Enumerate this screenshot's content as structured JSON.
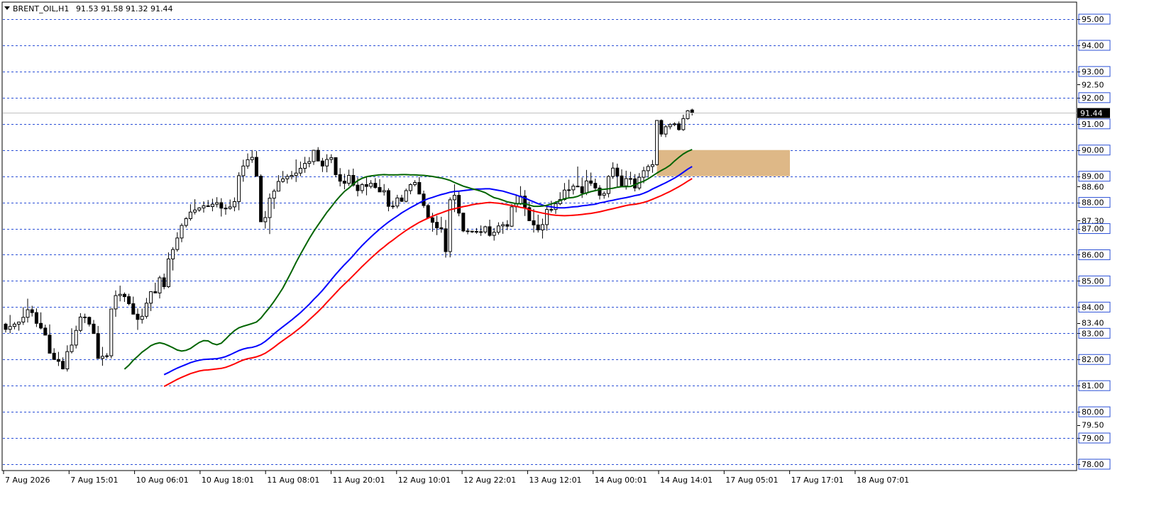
{
  "header": {
    "symbol": "BRENT_OIL,H1",
    "ohlc": "91.53 91.58 91.32 91.44"
  },
  "current_price_label": "91.44",
  "colors": {
    "bull_body": "#ffffff",
    "bear_body": "#000000",
    "ema_fast": "#006400",
    "ema_mid": "#0000ff",
    "ema_slow": "#ff0000",
    "zone": "#deb887",
    "grid": "#2a4fd6",
    "price_tag_bg": "#000000"
  },
  "chart_data": {
    "type": "candlestick",
    "title": "BRENT_OIL,H1",
    "ylim": [
      77.8,
      95.6
    ],
    "y_grid_levels": [
      "95.00",
      "94.00",
      "93.00",
      "92.00",
      "91.00",
      "90.00",
      "89.00",
      "88.00",
      "87.00",
      "86.00",
      "85.00",
      "84.00",
      "83.00",
      "82.00",
      "81.00",
      "80.00",
      "79.00",
      "78.00"
    ],
    "y_tick_labels": [
      "95.00",
      "94.00",
      "93.00",
      "92.50",
      "92.00",
      "91.00",
      "90.00",
      "89.00",
      "88.60",
      "88.00",
      "87.30",
      "87.00",
      "86.00",
      "85.00",
      "84.00",
      "83.40",
      "83.00",
      "82.00",
      "81.00",
      "80.00",
      "79.50",
      "79.00",
      "78.00"
    ],
    "x_tick_labels": [
      "7 Aug 2026",
      "7 Aug 15:01",
      "10 Aug 06:01",
      "10 Aug 18:01",
      "11 Aug 08:01",
      "11 Aug 20:01",
      "12 Aug 10:01",
      "12 Aug 22:01",
      "13 Aug 12:01",
      "14 Aug 00:01",
      "14 Aug 14:01",
      "17 Aug 05:01",
      "17 Aug 17:01",
      "18 Aug 07:01"
    ],
    "zone": {
      "from_price": 89.0,
      "to_price": 90.0,
      "start_bar": 148,
      "end_bar": 175
    },
    "ohlc": [
      [
        83.35,
        83.4,
        83.03,
        83.15
      ],
      [
        83.15,
        83.7,
        83.0,
        83.26
      ],
      [
        83.26,
        83.43,
        83.15,
        83.35
      ],
      [
        83.35,
        83.42,
        83.1,
        83.43
      ],
      [
        83.43,
        84.0,
        83.32,
        83.61
      ],
      [
        83.61,
        84.32,
        83.41,
        83.9
      ],
      [
        83.9,
        84.05,
        83.64,
        83.79
      ],
      [
        83.79,
        83.95,
        83.24,
        83.38
      ],
      [
        83.38,
        83.8,
        83.15,
        83.2
      ],
      [
        83.2,
        83.33,
        82.97,
        82.93
      ],
      [
        82.93,
        83.34,
        82.7,
        82.24
      ],
      [
        82.24,
        82.43,
        82.0,
        82.0
      ],
      [
        82.0,
        82.29,
        81.75,
        81.93
      ],
      [
        81.93,
        82.08,
        81.62,
        81.64
      ],
      [
        81.64,
        82.54,
        81.54,
        82.3
      ],
      [
        82.3,
        83.19,
        82.23,
        82.55
      ],
      [
        82.55,
        83.29,
        82.42,
        83.11
      ],
      [
        83.11,
        83.77,
        83.04,
        83.62
      ],
      [
        83.62,
        83.75,
        83.39,
        83.61
      ],
      [
        83.61,
        83.64,
        83.26,
        83.35
      ],
      [
        83.35,
        83.51,
        83.26,
        82.99
      ],
      [
        82.99,
        83.28,
        82.05,
        82.04
      ],
      [
        82.04,
        82.48,
        81.76,
        82.12
      ],
      [
        82.12,
        82.24,
        82.04,
        82.14
      ],
      [
        82.14,
        83.65,
        82.04,
        83.93
      ],
      [
        83.93,
        84.64,
        83.63,
        84.44
      ],
      [
        84.44,
        84.82,
        84.22,
        84.49
      ],
      [
        84.49,
        84.56,
        84.2,
        84.4
      ],
      [
        84.4,
        84.51,
        84.07,
        84.13
      ],
      [
        84.13,
        84.4,
        83.85,
        83.73
      ],
      [
        83.73,
        83.95,
        83.13,
        83.53
      ],
      [
        83.53,
        83.94,
        83.37,
        83.65
      ],
      [
        83.65,
        84.35,
        83.56,
        84.15
      ],
      [
        84.15,
        84.58,
        83.85,
        84.59
      ],
      [
        84.59,
        84.93,
        84.57,
        84.54
      ],
      [
        84.54,
        85.2,
        84.33,
        85.12
      ],
      [
        85.12,
        85.28,
        84.68,
        84.78
      ],
      [
        84.78,
        86.09,
        84.73,
        85.84
      ],
      [
        85.84,
        86.29,
        85.4,
        86.2
      ],
      [
        86.2,
        86.86,
        86.12,
        86.64
      ],
      [
        86.64,
        87.2,
        86.48,
        87.12
      ],
      [
        87.12,
        87.44,
        87.04,
        87.38
      ],
      [
        87.38,
        87.93,
        87.3,
        87.63
      ],
      [
        87.63,
        88.12,
        87.54,
        87.71
      ],
      [
        87.71,
        87.82,
        87.64,
        87.79
      ],
      [
        87.79,
        88.04,
        87.61,
        87.87
      ],
      [
        87.87,
        88.09,
        87.86,
        87.84
      ],
      [
        87.84,
        88.14,
        87.66,
        87.93
      ],
      [
        87.93,
        88.2,
        87.81,
        87.99
      ],
      [
        87.99,
        88.16,
        87.46,
        87.78
      ],
      [
        87.78,
        87.93,
        87.53,
        87.77
      ],
      [
        87.77,
        88.11,
        87.72,
        87.83
      ],
      [
        87.83,
        88.19,
        87.66,
        88.03
      ],
      [
        88.03,
        89.15,
        87.7,
        89.02
      ],
      [
        89.02,
        89.63,
        88.79,
        89.39
      ],
      [
        89.39,
        89.87,
        89.28,
        89.63
      ],
      [
        89.63,
        90.0,
        89.51,
        89.72
      ],
      [
        89.72,
        89.96,
        89.14,
        89.0
      ],
      [
        89.0,
        89.07,
        87.91,
        87.26
      ],
      [
        87.26,
        87.67,
        87.0,
        87.42
      ],
      [
        87.42,
        88.34,
        86.79,
        88.16
      ],
      [
        88.16,
        88.51,
        87.75,
        88.43
      ],
      [
        88.43,
        89.04,
        88.42,
        88.8
      ],
      [
        88.8,
        89.2,
        88.75,
        88.9
      ],
      [
        88.9,
        89.08,
        88.72,
        88.99
      ],
      [
        88.99,
        89.2,
        88.88,
        89.03
      ],
      [
        89.03,
        89.64,
        88.78,
        89.12
      ],
      [
        89.12,
        89.56,
        89.0,
        89.3
      ],
      [
        89.3,
        89.74,
        89.13,
        89.49
      ],
      [
        89.49,
        89.73,
        89.34,
        89.56
      ],
      [
        89.56,
        90.01,
        89.43,
        89.99
      ],
      [
        89.99,
        90.11,
        89.7,
        89.58
      ],
      [
        89.58,
        89.7,
        89.16,
        89.39
      ],
      [
        89.39,
        89.84,
        89.15,
        89.64
      ],
      [
        89.64,
        89.84,
        89.5,
        89.71
      ],
      [
        89.71,
        89.69,
        88.96,
        89.06
      ],
      [
        89.06,
        89.31,
        88.61,
        88.81
      ],
      [
        88.81,
        89.09,
        88.5,
        88.73
      ],
      [
        88.73,
        89.25,
        88.63,
        89.03
      ],
      [
        89.03,
        89.29,
        88.6,
        88.66
      ],
      [
        88.66,
        88.95,
        88.23,
        88.45
      ],
      [
        88.45,
        88.74,
        88.34,
        88.68
      ],
      [
        88.68,
        88.97,
        88.27,
        88.61
      ],
      [
        88.61,
        88.85,
        88.53,
        88.73
      ],
      [
        88.73,
        88.93,
        88.52,
        88.57
      ],
      [
        88.57,
        88.89,
        88.51,
        88.4
      ],
      [
        88.4,
        88.7,
        88.26,
        88.45
      ],
      [
        88.45,
        88.54,
        87.66,
        87.85
      ],
      [
        87.85,
        88.06,
        87.75,
        87.86
      ],
      [
        87.86,
        88.29,
        87.77,
        88.17
      ],
      [
        88.17,
        88.29,
        88.02,
        88.04
      ],
      [
        88.04,
        88.53,
        88.0,
        88.45
      ],
      [
        88.45,
        88.73,
        88.31,
        88.68
      ],
      [
        88.68,
        88.85,
        88.61,
        88.76
      ],
      [
        88.76,
        88.97,
        88.31,
        88.32
      ],
      [
        88.32,
        88.45,
        87.79,
        87.88
      ],
      [
        87.88,
        87.95,
        87.48,
        87.41
      ],
      [
        87.41,
        87.6,
        86.88,
        87.24
      ],
      [
        87.24,
        87.49,
        86.75,
        87.03
      ],
      [
        87.03,
        87.45,
        86.84,
        86.99
      ],
      [
        86.99,
        87.33,
        85.89,
        86.12
      ],
      [
        86.12,
        88.19,
        85.9,
        88.1
      ],
      [
        88.1,
        88.69,
        87.63,
        88.27
      ],
      [
        88.27,
        88.41,
        87.47,
        87.59
      ],
      [
        87.59,
        87.61,
        86.86,
        86.91
      ],
      [
        86.91,
        87.01,
        86.78,
        86.9
      ],
      [
        86.9,
        86.92,
        86.83,
        86.89
      ],
      [
        86.89,
        87.02,
        86.8,
        86.88
      ],
      [
        86.88,
        87.12,
        86.72,
        86.87
      ],
      [
        86.87,
        87.11,
        86.8,
        87.07
      ],
      [
        87.07,
        87.34,
        86.69,
        86.74
      ],
      [
        86.74,
        87.02,
        86.54,
        86.86
      ],
      [
        86.86,
        87.24,
        86.77,
        87.1
      ],
      [
        87.1,
        87.26,
        86.8,
        87.15
      ],
      [
        87.15,
        87.32,
        86.94,
        87.09
      ],
      [
        87.09,
        87.94,
        87.06,
        87.83
      ],
      [
        87.83,
        88.29,
        87.62,
        87.94
      ],
      [
        87.94,
        88.62,
        87.9,
        88.24
      ],
      [
        88.24,
        88.47,
        87.48,
        87.8
      ],
      [
        87.8,
        88.03,
        87.3,
        87.3
      ],
      [
        87.3,
        87.75,
        86.85,
        87.14
      ],
      [
        87.14,
        87.53,
        86.85,
        86.95
      ],
      [
        86.95,
        87.38,
        86.62,
        87.15
      ],
      [
        87.15,
        87.84,
        86.92,
        87.73
      ],
      [
        87.73,
        88.06,
        87.62,
        87.73
      ],
      [
        87.73,
        88.05,
        87.56,
        87.95
      ],
      [
        87.95,
        88.39,
        87.89,
        88.11
      ],
      [
        88.11,
        88.74,
        88.06,
        88.47
      ],
      [
        88.47,
        88.87,
        88.19,
        88.48
      ],
      [
        88.48,
        88.71,
        88.3,
        88.62
      ],
      [
        88.62,
        89.37,
        88.6,
        88.6
      ],
      [
        88.6,
        88.95,
        88.17,
        88.36
      ],
      [
        88.36,
        89.24,
        88.28,
        88.82
      ],
      [
        88.82,
        89.14,
        88.63,
        88.73
      ],
      [
        88.73,
        88.91,
        88.45,
        88.55
      ],
      [
        88.55,
        88.66,
        88.11,
        88.27
      ],
      [
        88.27,
        88.42,
        88.14,
        88.34
      ],
      [
        88.34,
        89.04,
        88.19,
        88.99
      ],
      [
        88.99,
        89.53,
        88.9,
        89.31
      ],
      [
        89.31,
        89.48,
        88.57,
        89.01
      ],
      [
        89.01,
        89.26,
        88.64,
        88.63
      ],
      [
        88.63,
        89.21,
        88.49,
        88.91
      ],
      [
        88.91,
        89.17,
        88.68,
        88.9
      ],
      [
        88.9,
        89.08,
        88.42,
        88.55
      ],
      [
        88.55,
        89.12,
        88.47,
        88.96
      ],
      [
        88.96,
        89.36,
        88.73,
        89.21
      ],
      [
        89.21,
        89.45,
        88.95,
        89.37
      ],
      [
        89.37,
        89.62,
        89.13,
        89.44
      ],
      [
        89.44,
        90.12,
        89.41,
        91.13
      ],
      [
        91.13,
        91.17,
        90.51,
        90.61
      ],
      [
        90.61,
        90.96,
        90.49,
        90.89
      ],
      [
        90.89,
        91.03,
        90.79,
        90.97
      ],
      [
        90.97,
        91.06,
        90.91,
        91.0
      ],
      [
        91.0,
        91.09,
        90.74,
        90.78
      ],
      [
        90.78,
        91.35,
        90.73,
        91.2
      ],
      [
        91.2,
        91.53,
        91.16,
        91.5
      ],
      [
        91.53,
        91.58,
        91.32,
        91.44
      ]
    ],
    "ema_fast": [
      81.63,
      81.78,
      81.97,
      82.12,
      82.28,
      82.4,
      82.53,
      82.6,
      82.64,
      82.6,
      82.53,
      82.45,
      82.36,
      82.32,
      82.35,
      82.42,
      82.54,
      82.65,
      82.72,
      82.71,
      82.61,
      82.56,
      82.62,
      82.78,
      82.95,
      83.1,
      83.21,
      83.27,
      83.32,
      83.37,
      83.43,
      83.58,
      83.79,
      83.99,
      84.22,
      84.47,
      84.73,
      85.05,
      85.37,
      85.71,
      86.02,
      86.32,
      86.62,
      86.89,
      87.14,
      87.38,
      87.62,
      87.83,
      88.05,
      88.24,
      88.42,
      88.55,
      88.7,
      88.83,
      88.92,
      88.98,
      89.01,
      89.03,
      89.05,
      89.06,
      89.05,
      89.05,
      89.05,
      89.06,
      89.06,
      89.05,
      89.05,
      89.04,
      89.03,
      89.01,
      88.99,
      88.96,
      88.93,
      88.89,
      88.84,
      88.76,
      88.69,
      88.62,
      88.57,
      88.52,
      88.48,
      88.43,
      88.37,
      88.27,
      88.18,
      88.14,
      88.08,
      88.02,
      87.99,
      87.95,
      87.95,
      87.94,
      87.9,
      87.85,
      87.85,
      87.86,
      87.89,
      87.94,
      88.0,
      88.07,
      88.14,
      88.17,
      88.19,
      88.23,
      88.31,
      88.36,
      88.41,
      88.45,
      88.49,
      88.5,
      88.52,
      88.54,
      88.58,
      88.6,
      88.6,
      88.61,
      88.67,
      88.75,
      88.81,
      88.9,
      89.01,
      89.12,
      89.22,
      89.31,
      89.42,
      89.58,
      89.72,
      89.85,
      89.95,
      90.02
    ],
    "ema_mid": [
      81.42,
      81.5,
      81.59,
      81.67,
      81.74,
      81.81,
      81.88,
      81.93,
      81.97,
      82.0,
      82.01,
      82.02,
      82.03,
      82.06,
      82.11,
      82.18,
      82.26,
      82.34,
      82.4,
      82.44,
      82.46,
      82.51,
      82.58,
      82.69,
      82.83,
      82.98,
      83.12,
      83.25,
      83.38,
      83.51,
      83.65,
      83.79,
      83.95,
      84.11,
      84.29,
      84.46,
      84.64,
      84.84,
      85.05,
      85.25,
      85.44,
      85.62,
      85.79,
      85.97,
      86.17,
      86.35,
      86.52,
      86.68,
      86.83,
      86.98,
      87.12,
      87.25,
      87.37,
      87.48,
      87.6,
      87.7,
      87.8,
      87.89,
      87.98,
      88.07,
      88.14,
      88.19,
      88.25,
      88.3,
      88.34,
      88.39,
      88.42,
      88.43,
      88.45,
      88.47,
      88.49,
      88.51,
      88.51,
      88.52,
      88.52,
      88.49,
      88.46,
      88.43,
      88.38,
      88.33,
      88.28,
      88.22,
      88.17,
      88.09,
      88.02,
      87.95,
      87.9,
      87.85,
      87.83,
      87.8,
      87.79,
      87.79,
      87.81,
      87.83,
      87.84,
      87.87,
      87.89,
      87.91,
      87.93,
      87.98,
      88.01,
      88.05,
      88.08,
      88.12,
      88.15,
      88.18,
      88.22,
      88.26,
      88.29,
      88.35,
      88.42,
      88.51,
      88.59,
      88.67,
      88.75,
      88.84,
      88.93,
      89.03,
      89.15,
      89.27,
      89.37
    ],
    "ema_slow": [
      80.97,
      81.06,
      81.15,
      81.24,
      81.32,
      81.39,
      81.46,
      81.51,
      81.56,
      81.59,
      81.6,
      81.62,
      81.64,
      81.66,
      81.7,
      81.76,
      81.83,
      81.91,
      81.98,
      82.03,
      82.06,
      82.1,
      82.16,
      82.24,
      82.35,
      82.47,
      82.6,
      82.72,
      82.84,
      82.96,
      83.09,
      83.22,
      83.36,
      83.52,
      83.67,
      83.83,
      84.0,
      84.18,
      84.36,
      84.54,
      84.72,
      84.88,
      85.04,
      85.21,
      85.38,
      85.55,
      85.71,
      85.87,
      86.02,
      86.17,
      86.3,
      86.44,
      86.56,
      86.69,
      86.81,
      86.93,
      87.04,
      87.14,
      87.24,
      87.32,
      87.4,
      87.47,
      87.54,
      87.6,
      87.66,
      87.72,
      87.76,
      87.8,
      87.84,
      87.87,
      87.91,
      87.94,
      87.96,
      87.98,
      88.0,
      87.98,
      87.97,
      87.94,
      87.91,
      87.88,
      87.85,
      87.81,
      87.78,
      87.72,
      87.67,
      87.63,
      87.59,
      87.56,
      87.53,
      87.51,
      87.5,
      87.49,
      87.5,
      87.51,
      87.52,
      87.54,
      87.56,
      87.58,
      87.61,
      87.64,
      87.68,
      87.72,
      87.76,
      87.8,
      87.84,
      87.88,
      87.91,
      87.93,
      87.96,
      88.0,
      88.05,
      88.12,
      88.19,
      88.26,
      88.34,
      88.42,
      88.51,
      88.6,
      88.7,
      88.81,
      88.91
    ]
  }
}
